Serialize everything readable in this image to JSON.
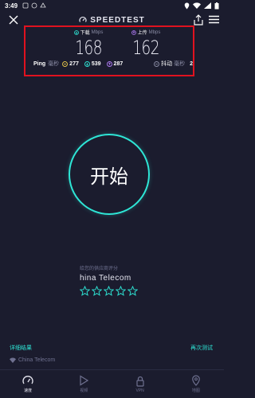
{
  "status_bar": {
    "time": "3:49"
  },
  "header": {
    "brand": "SPEEDTEST"
  },
  "results": {
    "download": {
      "label": "下载",
      "unit": "Mbps",
      "value": "168"
    },
    "upload": {
      "label": "上传",
      "unit": "Mbps",
      "value": "162"
    },
    "ping": {
      "label": "Ping",
      "unit": "毫秒",
      "idle": "277",
      "download": "539",
      "upload": "287"
    },
    "jitter": {
      "label": "抖动",
      "unit": "毫秒",
      "value": "2"
    }
  },
  "go_button": {
    "label": "开始"
  },
  "provider": {
    "hint": "给您的供应商评分",
    "name": "hina Telecom",
    "stars": 5
  },
  "links": {
    "details": "详细结果",
    "retest": "再次测试"
  },
  "isp_footer": "China Telecom",
  "tabs": [
    {
      "label": "速度",
      "icon": "speedometer-icon",
      "active": true
    },
    {
      "label": "视频",
      "icon": "play-icon",
      "active": false
    },
    {
      "label": "VPN",
      "icon": "lock-icon",
      "active": false
    },
    {
      "label": "地图",
      "icon": "map-pin-icon",
      "active": false
    }
  ],
  "colors": {
    "background": "#1b1c2e",
    "accent": "#2ee6d6",
    "highlight_box": "#e0121f",
    "download": "#2ee6d6",
    "upload": "#b07cf5",
    "idle": "#e8c84a"
  }
}
